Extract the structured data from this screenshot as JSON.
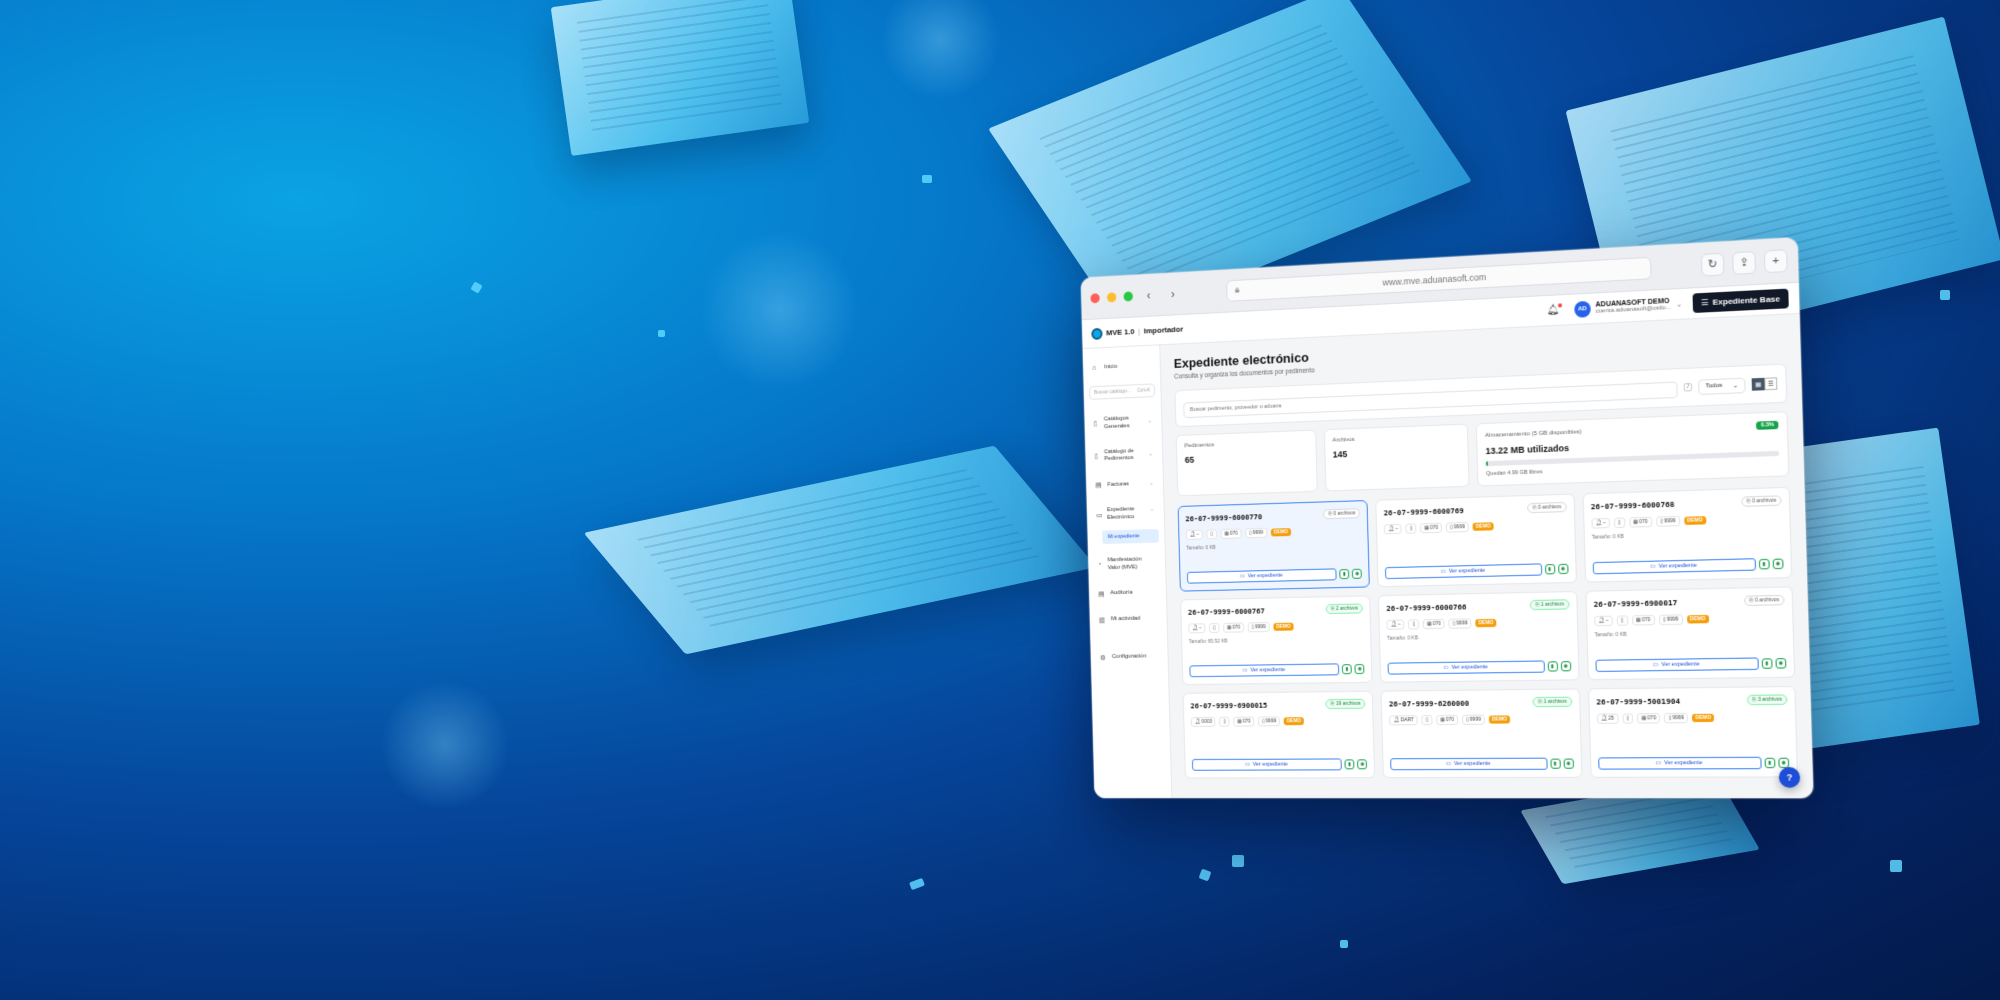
{
  "browser": {
    "url": "www.mve.aduanasoft.com",
    "back_icon": "‹",
    "forward_icon": "›",
    "reload_icon": "↻",
    "share_icon": "⇪",
    "new_tab_icon": "+",
    "user_initials": "AD",
    "user_name": "ADUANASOFT DEMO",
    "user_email": "cuenta.aduanasoft@ostlo..."
  },
  "app": {
    "brand": "MVE 1.0",
    "role": "Importador",
    "base_button": "Expediente Base"
  },
  "sidebar": {
    "search_placeholder": "Buscar catálogo...",
    "search_shortcut": "Ctrl+K",
    "items": [
      {
        "label": "Inicio",
        "icon": "⌂"
      },
      {
        "label": "Catálogos Generales",
        "icon": "▯"
      },
      {
        "label": "Catálogo de Pedimentos",
        "icon": "▯"
      },
      {
        "label": "Facturas",
        "icon": "▤"
      },
      {
        "label": "Expediente Electrónico",
        "icon": "▭"
      },
      {
        "label": "Manifestación Valor (MVE)",
        "icon": "◔"
      },
      {
        "label": "Auditoría",
        "icon": "▤"
      },
      {
        "label": "Mi actividad",
        "icon": "▥"
      },
      {
        "label": "Configuración",
        "icon": "⚙"
      }
    ],
    "sub_item": "Mi expediente"
  },
  "main": {
    "title": "Expediente electrónico",
    "subtitle": "Consulta y organiza los documentos por pedimento",
    "search_placeholder": "Buscar pedimento, proveedor o aduana",
    "slash": "/",
    "filter_value": "Todos",
    "stats": {
      "pedimentos_label": "Pedimentos",
      "pedimentos_value": "65",
      "archivos_label": "Archivos",
      "archivos_value": "145",
      "storage_label": "Almacenamiento (5 GB disponibles)",
      "storage_used": "13.22 MB utilizados",
      "storage_pct": "0.3%",
      "storage_fraction": 0.003,
      "storage_free": "Quedan 4.99 GB libres"
    },
    "view_button": "Ver expediente",
    "cards": [
      {
        "num": "26-07-9999-6000770",
        "files": "0 archivos",
        "meta": [
          "–",
          "070",
          "9999"
        ],
        "demo": "DEMO",
        "size": "Tamaño: 0 KB"
      },
      {
        "num": "26-07-9999-6000769",
        "files": "0 archivos",
        "meta": [
          "–",
          "070",
          "9999"
        ],
        "demo": "DEMO",
        "size": ""
      },
      {
        "num": "26-07-9999-6000768",
        "files": "0 archivos",
        "meta": [
          "–",
          "070",
          "9999"
        ],
        "demo": "DEMO",
        "size": "Tamaño: 0 KB"
      },
      {
        "num": "26-07-9999-6000767",
        "files": "2 archivos",
        "meta": [
          "–",
          "070",
          "9999"
        ],
        "demo": "DEMO",
        "size": "Tamaño: 65.52 KB"
      },
      {
        "num": "26-07-9999-6000766",
        "files": "1 archivos",
        "meta": [
          "–",
          "070",
          "9999"
        ],
        "demo": "DEMO",
        "size": "Tamaño: 0 KB"
      },
      {
        "num": "26-07-9999-6900017",
        "files": "0 archivos",
        "meta": [
          "–",
          "070",
          "9999"
        ],
        "demo": "DEMO",
        "size": "Tamaño: 0 KB"
      },
      {
        "num": "26-07-9999-6900015",
        "files": "19 archivos",
        "meta": [
          "0003",
          "070",
          "9999"
        ],
        "demo": "DEMO",
        "size": ""
      },
      {
        "num": "26-07-9999-6260000",
        "files": "1 archivos",
        "meta": [
          "DART",
          "070",
          "9999"
        ],
        "demo": "DEMO",
        "size": ""
      },
      {
        "num": "26-07-9999-5001904",
        "files": "3 archivos",
        "meta": [
          "25",
          "070",
          "9999"
        ],
        "demo": "DEMO",
        "size": ""
      }
    ],
    "help_icon": "?"
  }
}
